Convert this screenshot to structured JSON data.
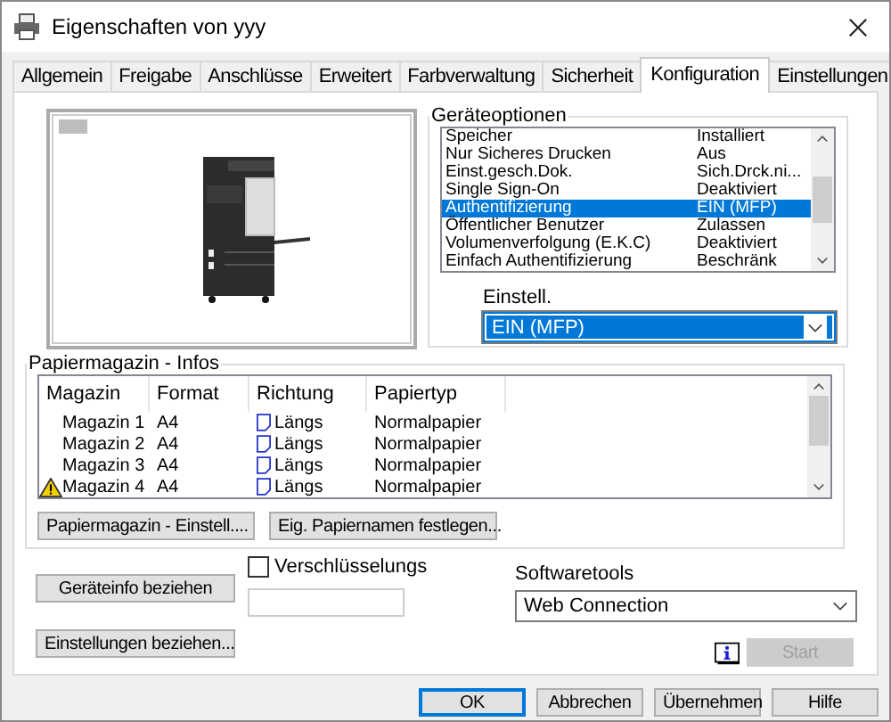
{
  "window": {
    "title": "Eigenschaften von yyy"
  },
  "tabs": [
    {
      "label": "Allgemein",
      "selected": false
    },
    {
      "label": "Freigabe",
      "selected": false
    },
    {
      "label": "Anschlüsse",
      "selected": false
    },
    {
      "label": "Erweitert",
      "selected": false
    },
    {
      "label": "Farbverwaltung",
      "selected": false
    },
    {
      "label": "Sicherheit",
      "selected": false
    },
    {
      "label": "Konfiguration",
      "selected": true
    },
    {
      "label": "Einstellungen",
      "selected": false
    }
  ],
  "device_options": {
    "title": "Geräteoptionen",
    "items": [
      {
        "name": "Speicher",
        "value": "Installiert",
        "selected": false
      },
      {
        "name": "Nur Sicheres Drucken",
        "value": "Aus",
        "selected": false
      },
      {
        "name": "Einst.gesch.Dok.",
        "value": "Sich.Drck.ni...",
        "selected": false
      },
      {
        "name": "Single Sign-On",
        "value": "Deaktiviert",
        "selected": false
      },
      {
        "name": "Authentifizierung",
        "value": "EIN (MFP)",
        "selected": true
      },
      {
        "name": "Öffentlicher Benutzer",
        "value": "Zulassen",
        "selected": false
      },
      {
        "name": "Volumenverfolgung (E.K.C)",
        "value": "Deaktiviert",
        "selected": false
      },
      {
        "name": "Einfach Authentifizierung",
        "value": "Beschränk",
        "selected": false
      }
    ],
    "setting_label": "Einstell.",
    "setting_value": "EIN (MFP)"
  },
  "paper_trays": {
    "title": "Papiermagazin - Infos",
    "columns": [
      "Magazin",
      "Format",
      "Richtung",
      "Papiertyp"
    ],
    "rows": [
      {
        "tray": "Magazin 1",
        "format": "A4",
        "direction": "Längs",
        "type": "Normalpapier",
        "warning": false
      },
      {
        "tray": "Magazin 2",
        "format": "A4",
        "direction": "Längs",
        "type": "Normalpapier",
        "warning": false
      },
      {
        "tray": "Magazin 3",
        "format": "A4",
        "direction": "Längs",
        "type": "Normalpapier",
        "warning": false
      },
      {
        "tray": "Magazin 4",
        "format": "A4",
        "direction": "Längs",
        "type": "Normalpapier",
        "warning": true
      }
    ],
    "buttons": [
      "Papiermagazin - Einstell....",
      "Eig. Papiernamen festlegen..."
    ]
  },
  "get_device_info_button": "Geräteinfo beziehen",
  "get_settings_button": "Einstellungen beziehen...",
  "encryption": {
    "label": "Verschlüsselungs",
    "checked": false
  },
  "software_tools": {
    "label": "Softwaretools",
    "value": "Web Connection",
    "start_button": "Start",
    "start_disabled": true
  },
  "buttons": [
    {
      "label": "OK",
      "default": true
    },
    {
      "label": "Abbrechen",
      "default": false
    },
    {
      "label": "Übernehmen",
      "default": false
    },
    {
      "label": "Hilfe",
      "default": false
    }
  ]
}
